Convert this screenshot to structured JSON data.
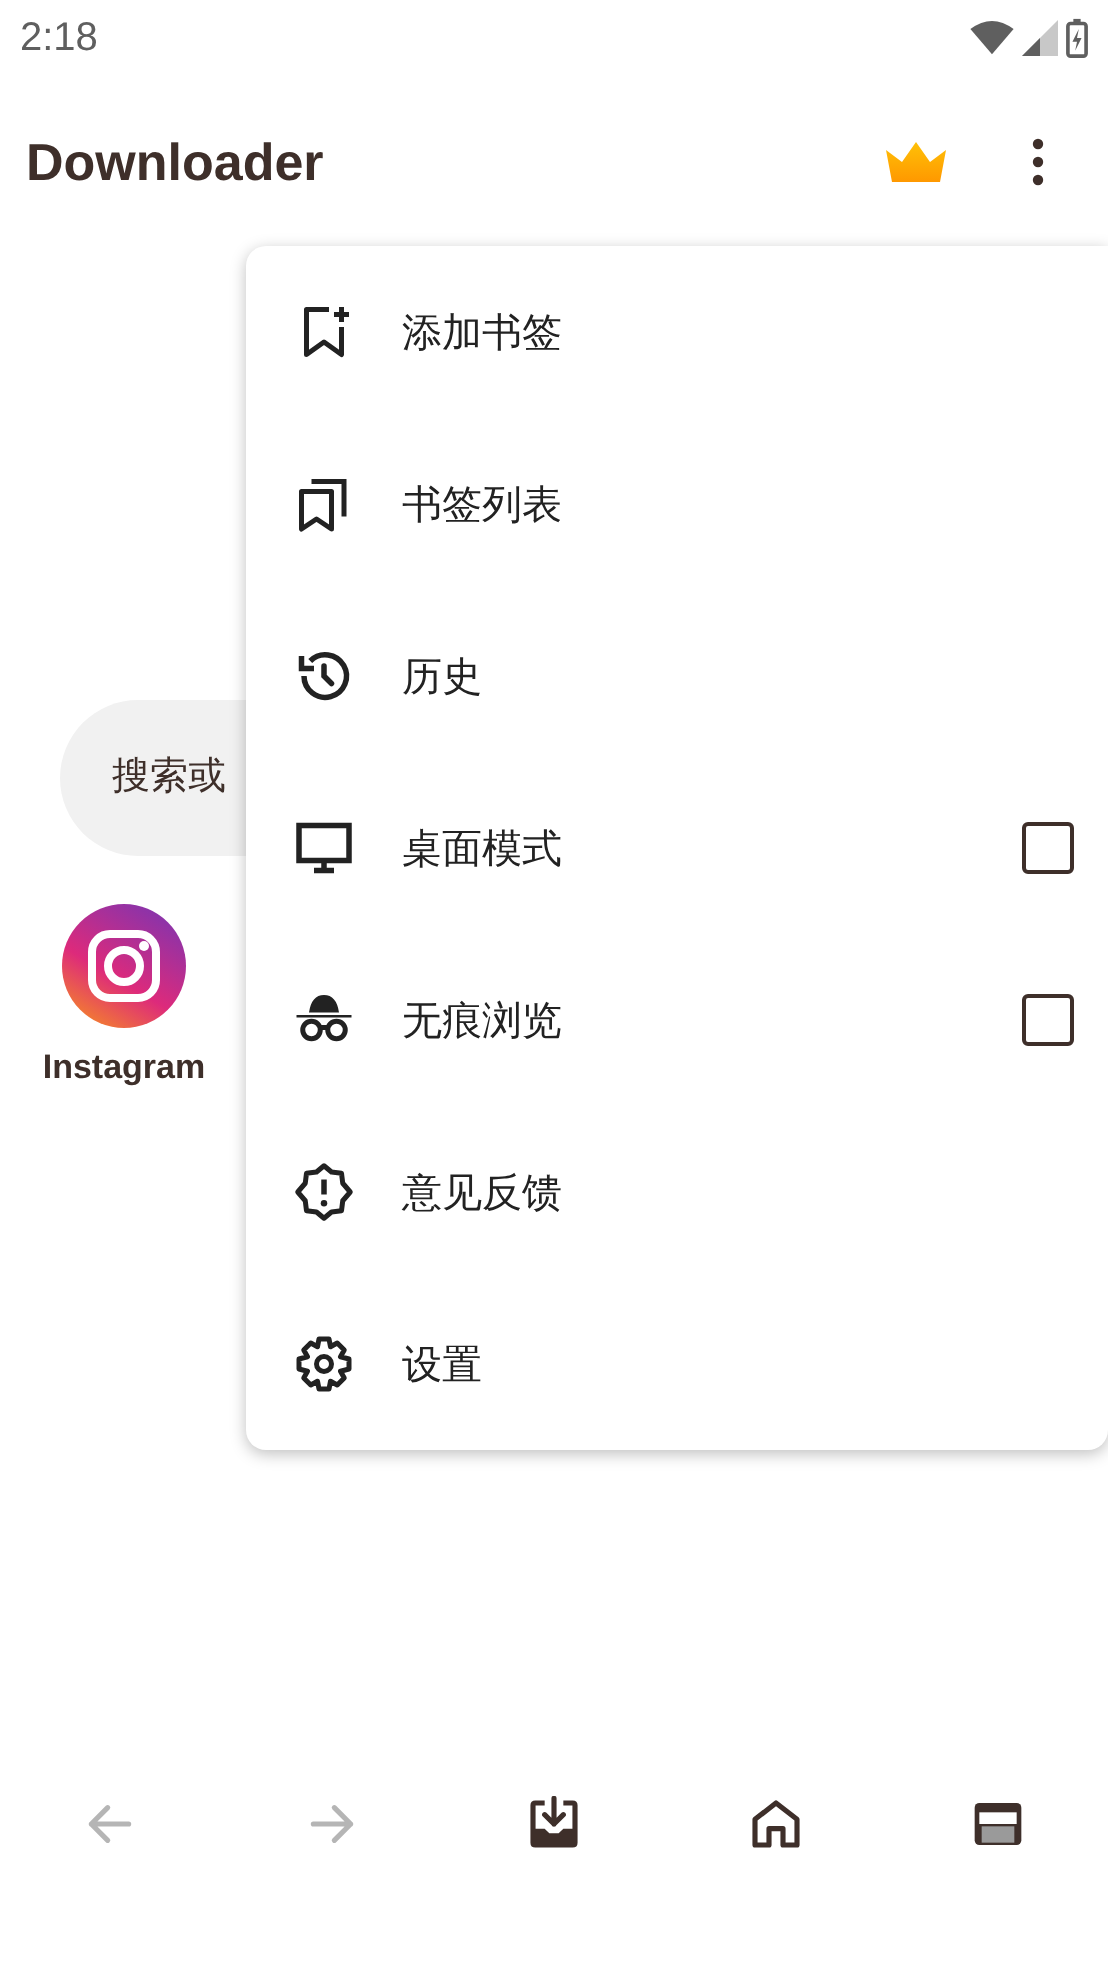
{
  "status_bar": {
    "time": "2:18"
  },
  "app_bar": {
    "title": "Downloader"
  },
  "search": {
    "placeholder": "搜索或"
  },
  "shortcuts": [
    {
      "label": "Instagram"
    }
  ],
  "menu": {
    "items": [
      {
        "label": "添加书签",
        "kind": "action"
      },
      {
        "label": "书签列表",
        "kind": "action"
      },
      {
        "label": "历史",
        "kind": "action"
      },
      {
        "label": "桌面模式",
        "kind": "toggle",
        "checked": false
      },
      {
        "label": "无痕浏览",
        "kind": "toggle",
        "checked": false
      },
      {
        "label": "意见反馈",
        "kind": "action"
      },
      {
        "label": "设置",
        "kind": "action"
      }
    ]
  },
  "bottom_nav": [
    {
      "disabled": true
    },
    {
      "disabled": true
    },
    {
      "disabled": false
    },
    {
      "disabled": false
    },
    {
      "disabled": false
    }
  ]
}
